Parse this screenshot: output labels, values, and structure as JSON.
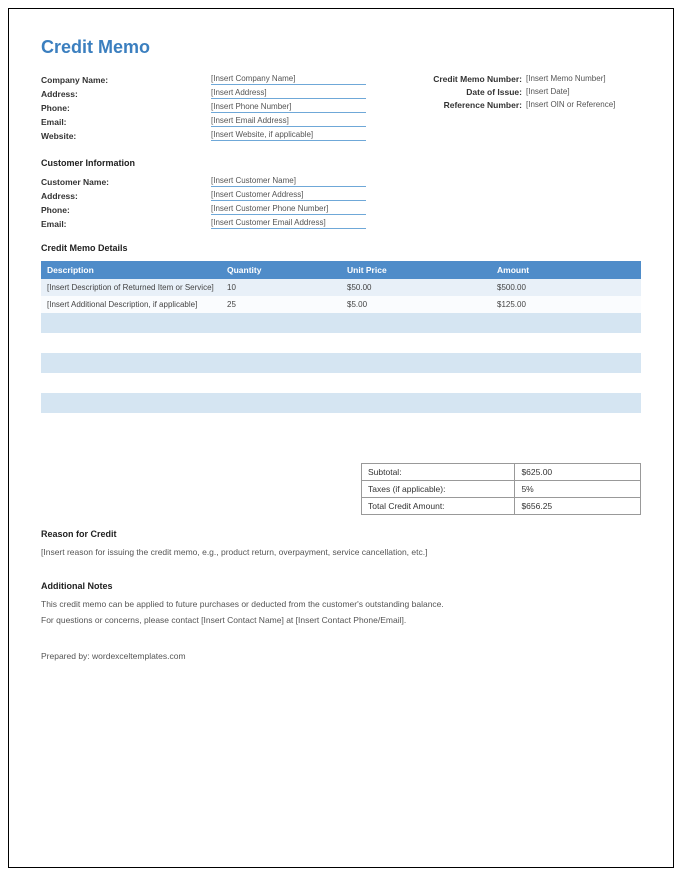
{
  "title": "Credit Memo",
  "company": {
    "name_label": "Company Name:",
    "name_value": "[Insert Company Name]",
    "address_label": "Address:",
    "address_value": "[Insert Address]",
    "phone_label": "Phone:",
    "phone_value": "[Insert Phone Number]",
    "email_label": "Email:",
    "email_value": "[Insert Email Address]",
    "website_label": "Website:",
    "website_value": "[Insert Website, if applicable]"
  },
  "memo_meta": {
    "number_label": "Credit Memo Number:",
    "number_value": "[Insert Memo Number]",
    "date_label": "Date of Issue:",
    "date_value": "[Insert Date]",
    "ref_label": "Reference Number:",
    "ref_value": "[Insert OIN or Reference]"
  },
  "customer_heading": "Customer Information",
  "customer": {
    "name_label": "Customer Name:",
    "name_value": "[Insert Customer Name]",
    "address_label": "Address:",
    "address_value": "[Insert Customer Address]",
    "phone_label": "Phone:",
    "phone_value": "[Insert Customer Phone Number]",
    "email_label": "Email:",
    "email_value": "[Insert Customer Email Address]"
  },
  "details_heading": "Credit Memo Details",
  "details": {
    "headers": {
      "desc": "Description",
      "qty": "Quantity",
      "unit": "Unit Price",
      "amount": "Amount"
    },
    "rows": [
      {
        "desc": "[Insert Description of Returned Item or Service]",
        "qty": "10",
        "unit": "$50.00",
        "amount": "$500.00"
      },
      {
        "desc": "[Insert Additional Description, if applicable]",
        "qty": "25",
        "unit": "$5.00",
        "amount": "$125.00"
      }
    ]
  },
  "totals": {
    "subtotal_label": "Subtotal:",
    "subtotal_value": "$625.00",
    "taxes_label": "Taxes (if applicable):",
    "taxes_value": "5%",
    "total_label": "Total Credit Amount:",
    "total_value": "$656.25"
  },
  "reason_heading": "Reason for Credit",
  "reason_text": "[Insert reason for issuing the credit memo, e.g., product return, overpayment, service cancellation, etc.]",
  "notes_heading": "Additional Notes",
  "notes_line1": "This credit memo can be applied to future purchases or deducted from the customer's outstanding balance.",
  "notes_line2": "For questions or concerns, please contact [Insert Contact Name] at [Insert Contact Phone/Email].",
  "prepared_by": "Prepared by: wordexceltemplates.com"
}
